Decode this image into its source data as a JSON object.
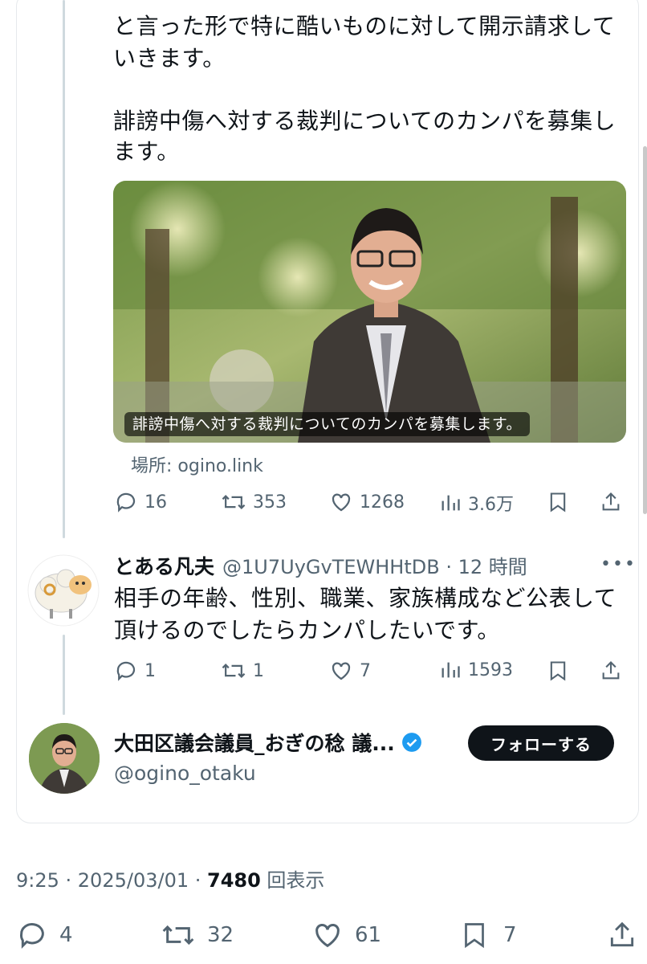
{
  "main_tweet": {
    "text_line1": "と言った形で特に酷いものに対して開示請求して",
    "text_line2": "いきます。",
    "text_line3": "誹謗中傷へ対する裁判についてのカンパを募集し",
    "text_line4": "ます。",
    "media_caption": "誹謗中傷へ対する裁判についてのカンパを募集します。",
    "link_card": "場所: ogino.link",
    "replies": "16",
    "retweets": "353",
    "likes": "1268",
    "views": "3.6万"
  },
  "reply_tweet": {
    "name": "とある凡夫",
    "handle_time": "@1U7UyGvTEWHHtDB · 12 時間",
    "text_line1": "相手の年齢、性別、職業、家族構成など公表して",
    "text_line2": "頂けるのでしたらカンパしたいです。",
    "replies": "1",
    "retweets": "1",
    "likes": "7",
    "views": "1593"
  },
  "author_card": {
    "name": "大田区議会議員_おぎの稔 議...",
    "handle": "@ogino_otaku",
    "follow_label": "フォローする"
  },
  "timestamp": {
    "time_date": "9:25 · 2025/03/01 · ",
    "view_count": "7480",
    "view_label": " 回表示"
  },
  "bottom_bar": {
    "replies": "4",
    "retweets": "32",
    "likes": "61",
    "bookmarks": "7"
  },
  "colors": {
    "text": "#0f1419",
    "secondary": "#536471",
    "verified": "#1d9bf0",
    "button_bg": "#0f1419"
  }
}
